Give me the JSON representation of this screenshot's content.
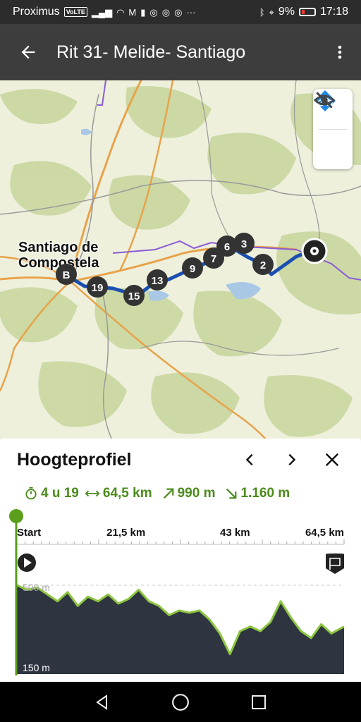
{
  "status_bar": {
    "carrier": "Proximus",
    "volte": "VoLTE",
    "battery_percent": "9%",
    "time": "17:18"
  },
  "app_bar": {
    "title": "Rit 31- Melide- Santiago",
    "back_icon": "arrow-left-icon",
    "menu_icon": "more-vert-icon"
  },
  "map": {
    "city_label_line1": "Santiago de",
    "city_label_line2": "Compostela",
    "waypoints": [
      "B",
      "19",
      "15",
      "13",
      "9",
      "7",
      "6",
      "3",
      "2"
    ],
    "controls": [
      {
        "icon": "bike-layer-icon"
      },
      {
        "icon": "eye-off-icon"
      }
    ],
    "colors": {
      "route": "#1a4fb0",
      "waypoint": "#333333"
    }
  },
  "elevation": {
    "title": "Hoogteprofiel",
    "duration": "4 u 19",
    "distance": "64,5 km",
    "ascent": "990 m",
    "descent": "1.160 m",
    "axis_labels": [
      "Start",
      "21,5 km",
      "43 km",
      "64,5 km"
    ],
    "y_labels": [
      "500 m",
      "150 m"
    ],
    "accent_color": "#5a9e1a"
  },
  "chart_data": {
    "type": "area",
    "x": [
      0,
      2,
      4,
      6,
      8,
      10,
      12,
      14,
      16,
      18,
      20,
      22,
      24,
      26,
      28,
      30,
      32,
      34,
      36,
      38,
      40,
      42,
      44,
      46,
      48,
      50,
      52,
      54,
      56,
      58,
      60,
      62,
      64.5
    ],
    "y": [
      500,
      480,
      490,
      460,
      430,
      470,
      410,
      450,
      430,
      460,
      420,
      440,
      480,
      430,
      410,
      370,
      390,
      380,
      390,
      350,
      290,
      200,
      300,
      320,
      300,
      340,
      430,
      360,
      300,
      270,
      330,
      290,
      320
    ],
    "xlabel": "",
    "ylabel": "",
    "xlim": [
      0,
      64.5
    ],
    "ylim": [
      150,
      500
    ],
    "x_ticks": [
      "Start",
      "21,5 km",
      "43 km",
      "64,5 km"
    ],
    "y_ticks": [
      "500 m",
      "150 m"
    ],
    "grid": true
  },
  "nav_bar": {
    "back_icon": "triangle-back-icon",
    "home_icon": "circle-home-icon",
    "recents_icon": "square-recents-icon"
  }
}
